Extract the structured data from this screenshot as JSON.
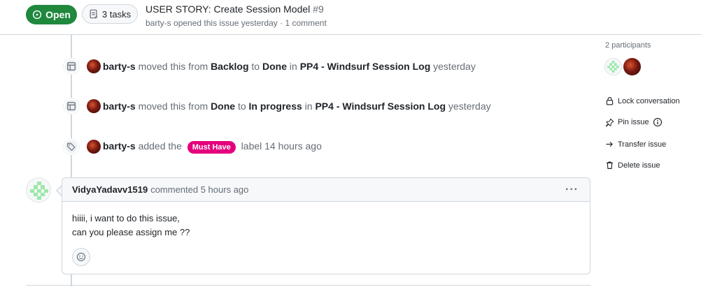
{
  "header": {
    "status": "Open",
    "tasks_label": "3 tasks",
    "title": "USER STORY: Create Session Model",
    "number": "#9",
    "meta_author": "barty-s",
    "meta_text": " opened this issue yesterday · 1 comment"
  },
  "events": [
    {
      "icon": "project-icon",
      "actor": "barty-s",
      "t1": " moved this from ",
      "from": "Backlog",
      "t2": " to ",
      "to": "Done",
      "t3": " in ",
      "project": "PP4 - Windsurf Session Log",
      "time": " yesterday"
    },
    {
      "icon": "project-icon",
      "actor": "barty-s",
      "t1": " moved this from ",
      "from": "Done",
      "t2": " to ",
      "to": "In progress",
      "t3": " in ",
      "project": "PP4 - Windsurf Session Log",
      "time": " yesterday"
    },
    {
      "icon": "tag-icon",
      "actor": "barty-s",
      "t1": " added the ",
      "label": "Must Have",
      "t2": " label 14 hours ago"
    }
  ],
  "comment": {
    "author": "VidyaYadavv1519",
    "meta": "commented 5 hours ago",
    "line1": "hiiii, i want to do this issue,",
    "line2": "can you please assign me ??"
  },
  "sidebar": {
    "participants_label": "2 participants",
    "lock": "Lock conversation",
    "pin": "Pin issue",
    "transfer": "Transfer issue",
    "delete": "Delete issue"
  },
  "colors": {
    "open_green": "#1f883d",
    "label_pink": "#e4007c",
    "identicon_green": "#9be9a8"
  }
}
